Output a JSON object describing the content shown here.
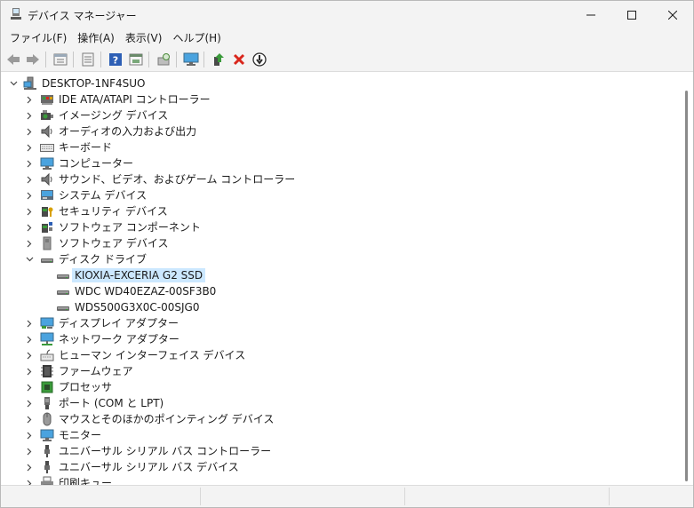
{
  "window": {
    "title": "デバイス マネージャー"
  },
  "menu": [
    {
      "label": "ファイル(F)"
    },
    {
      "label": "操作(A)"
    },
    {
      "label": "表示(V)"
    },
    {
      "label": "ヘルプ(H)"
    }
  ],
  "toolbar": {
    "icons": [
      "back-icon",
      "forward-icon",
      "properties-icon",
      "view-icon",
      "help-icon",
      "action-icon",
      "scan-icon",
      "monitor-icon",
      "update-driver-icon",
      "uninstall-icon",
      "disable-icon"
    ]
  },
  "tree": {
    "root": "DESKTOP-1NF4SUO",
    "categories": [
      {
        "label": "IDE ATA/ATAPI コントローラー",
        "icon": "ide-icon"
      },
      {
        "label": "イメージング デバイス",
        "icon": "camera-icon"
      },
      {
        "label": "オーディオの入力および出力",
        "icon": "speaker-icon"
      },
      {
        "label": "キーボード",
        "icon": "keyboard-icon"
      },
      {
        "label": "コンピューター",
        "icon": "computer-icon"
      },
      {
        "label": "サウンド、ビデオ、およびゲーム コントローラー",
        "icon": "speaker-icon"
      },
      {
        "label": "システム デバイス",
        "icon": "system-icon"
      },
      {
        "label": "セキュリティ デバイス",
        "icon": "security-icon"
      },
      {
        "label": "ソフトウェア コンポーネント",
        "icon": "software-component-icon"
      },
      {
        "label": "ソフトウェア デバイス",
        "icon": "software-device-icon"
      },
      {
        "label": "ディスク ドライブ",
        "icon": "disk-icon",
        "expanded": true
      },
      {
        "label": "ディスプレイ アダプター",
        "icon": "display-icon"
      },
      {
        "label": "ネットワーク アダプター",
        "icon": "network-icon"
      },
      {
        "label": "ヒューマン インターフェイス デバイス",
        "icon": "hid-icon"
      },
      {
        "label": "ファームウェア",
        "icon": "chip-icon"
      },
      {
        "label": "プロセッサ",
        "icon": "processor-icon"
      },
      {
        "label": "ポート (COM と LPT)",
        "icon": "port-icon"
      },
      {
        "label": "マウスとそのほかのポインティング デバイス",
        "icon": "mouse-icon"
      },
      {
        "label": "モニター",
        "icon": "monitor-icon"
      },
      {
        "label": "ユニバーサル シリアル バス コントローラー",
        "icon": "usb-icon"
      },
      {
        "label": "ユニバーサル シリアル バス デバイス",
        "icon": "usb-icon"
      },
      {
        "label": "印刷キュー",
        "icon": "printer-icon"
      }
    ],
    "disk_children": [
      {
        "label": "KIOXIA-EXCERIA G2 SSD",
        "selected": true
      },
      {
        "label": "WDC WD40EZAZ-00SF3B0"
      },
      {
        "label": "WDS500G3X0C-00SJG0"
      }
    ]
  },
  "colors": {
    "selection": "#cce8ff",
    "accent": "#0067c0"
  }
}
